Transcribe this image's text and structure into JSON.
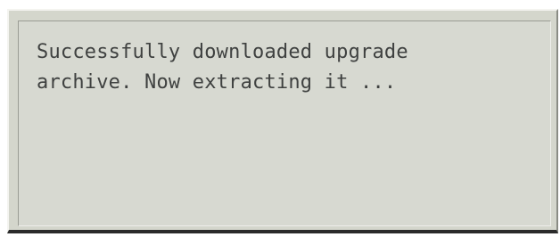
{
  "dialog": {
    "message_lines": [
      "Successfully downloaded upgrade",
      "archive. Now extracting it ..."
    ]
  }
}
